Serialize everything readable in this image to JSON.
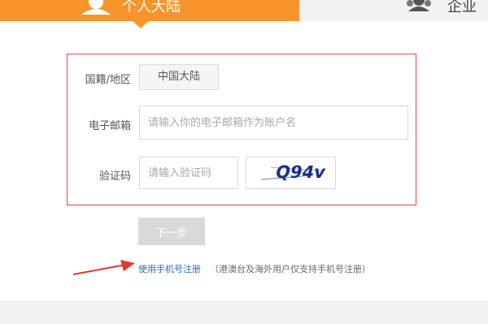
{
  "tabs": {
    "active": {
      "label": "个人大陆",
      "icon": "person-icon"
    },
    "inactive": {
      "label": "企业",
      "icon": "group-icon"
    }
  },
  "form": {
    "country": {
      "label": "国籍/地区",
      "value": "中国大陆"
    },
    "email": {
      "label": "电子邮箱",
      "placeholder": "请输入你的电子邮箱作为账户名",
      "value": ""
    },
    "captcha": {
      "label": "验证码",
      "placeholder": "请输入验证码",
      "value": "",
      "image_text": "Q94v"
    }
  },
  "next_button": {
    "label": "下一步"
  },
  "phone_register": {
    "link": "使用手机号注册",
    "note": "（港澳台及海外用户仅支持手机号注册）"
  },
  "colors": {
    "accent": "#f7952c",
    "panel_border": "#e54646",
    "link": "#2a6bb8",
    "button_disabled": "#d9d9d9",
    "arrow": "#e03a2c"
  }
}
